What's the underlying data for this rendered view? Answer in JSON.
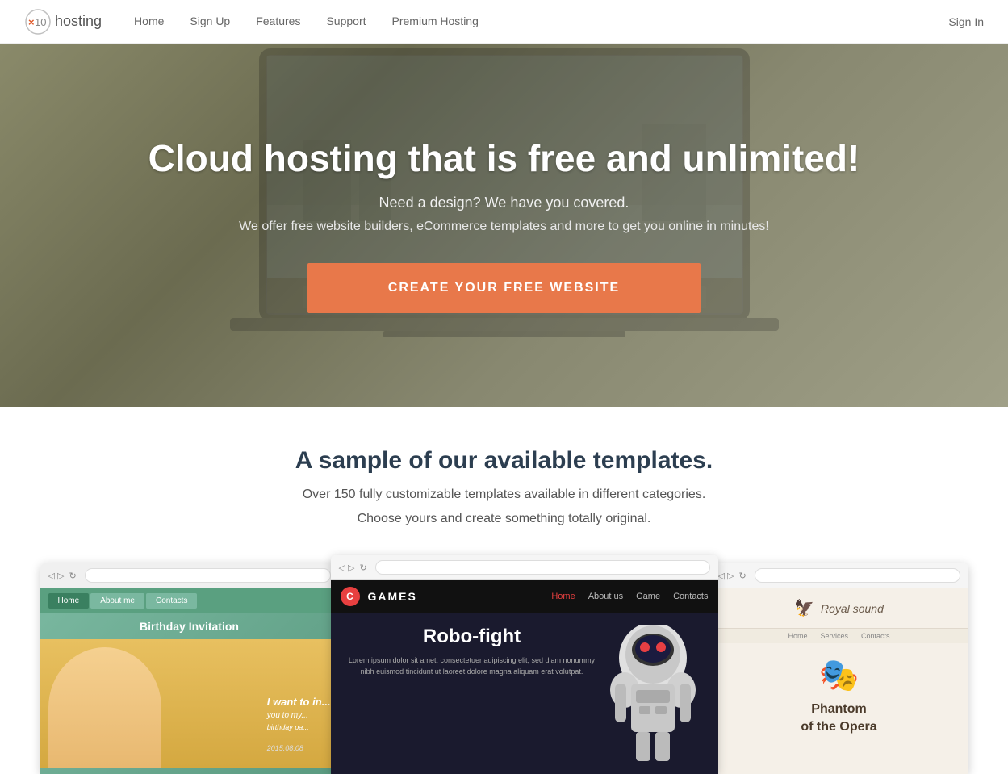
{
  "navbar": {
    "logo": {
      "prefix": "×",
      "number": "10",
      "suffix": "hosting"
    },
    "links": [
      {
        "label": "Home",
        "href": "#"
      },
      {
        "label": "Sign Up",
        "href": "#"
      },
      {
        "label": "Features",
        "href": "#"
      },
      {
        "label": "Support",
        "href": "#"
      },
      {
        "label": "Premium Hosting",
        "href": "#"
      }
    ],
    "signin": "Sign In"
  },
  "hero": {
    "title": "Cloud hosting that is free and unlimited!",
    "subtitle": "Need a design? We have you covered.",
    "description": "We offer free website builders, eCommerce templates and more to get you online in minutes!",
    "cta_label": "CREATE YOUR FREE WEBSITE"
  },
  "templates_section": {
    "heading": "A sample of our available templates.",
    "sub1": "Over 150 fully customizable templates available in different categories.",
    "sub2": "Choose yours and create something totally original.",
    "templates": [
      {
        "name": "Birthday Invitation",
        "type": "left"
      },
      {
        "name": "Games - Robo-fight",
        "brand": "GAMES",
        "title": "Robo-fight",
        "body": "Lorem ipsum dolor sit amet, consectetuer adipiscing elit, sed diam nonummy nibh euismod tincidunt ut laoreet dolore magna aliquam erat volutpat.",
        "nav_links": [
          "Home",
          "About us",
          "Game",
          "Contacts"
        ],
        "type": "center"
      },
      {
        "name": "Phantom of the Opera",
        "title": "Phantom\nof the Opera",
        "brand": "Royal sound",
        "nav_links": [
          "Home",
          "Services",
          "Contacts"
        ],
        "type": "right"
      }
    ]
  },
  "colors": {
    "cta_orange": "#e8784a",
    "nav_text": "#666666",
    "hero_overlay": "rgba(0,0,0,0.15)"
  }
}
